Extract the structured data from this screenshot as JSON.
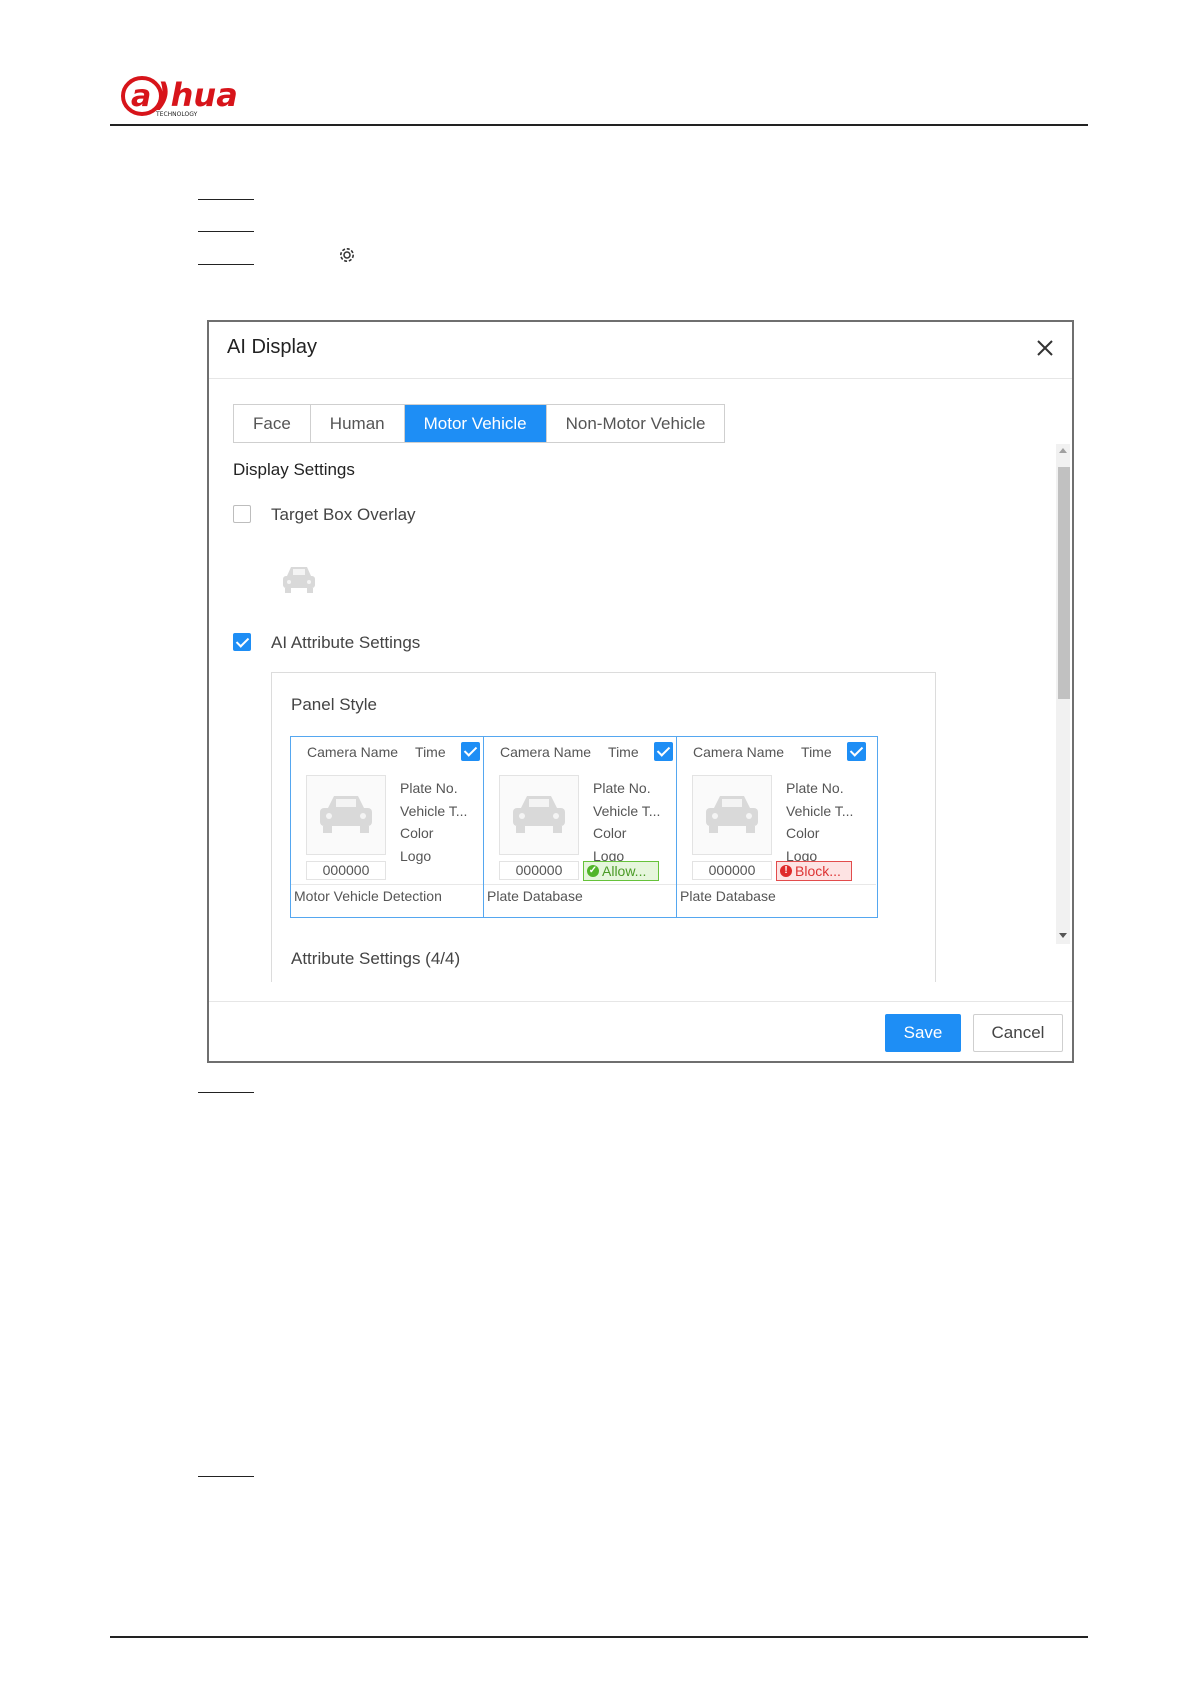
{
  "header": {
    "logo_text": "alhua",
    "logo_subtext": "TECHNOLOGY"
  },
  "dialog": {
    "title": "AI Display",
    "tabs": [
      {
        "label": "Face",
        "active": false
      },
      {
        "label": "Human",
        "active": false
      },
      {
        "label": "Motor Vehicle",
        "active": true
      },
      {
        "label": "Non-Motor Vehicle",
        "active": false
      }
    ],
    "display_settings_title": "Display Settings",
    "target_box_overlay": {
      "label": "Target Box Overlay",
      "checked": false
    },
    "ai_attribute_settings": {
      "label": "AI Attribute Settings",
      "checked": true
    },
    "panel_style_title": "Panel Style",
    "cards": [
      {
        "camera_name": "Camera Name",
        "time": "Time",
        "checked": true,
        "attributes": [
          "Plate No.",
          "Vehicle T...",
          "Color",
          "Logo"
        ],
        "plate_value": "000000",
        "badge": null,
        "footer": "Motor Vehicle Detection"
      },
      {
        "camera_name": "Camera Name",
        "time": "Time",
        "checked": true,
        "attributes": [
          "Plate No.",
          "Vehicle T...",
          "Color",
          "Logo"
        ],
        "plate_value": "000000",
        "badge": "Allow...",
        "badge_type": "allow",
        "footer": "Plate Database"
      },
      {
        "camera_name": "Camera Name",
        "time": "Time",
        "checked": true,
        "attributes": [
          "Plate No.",
          "Vehicle T...",
          "Color",
          "Logo"
        ],
        "plate_value": "000000",
        "badge": "Block...",
        "badge_type": "block",
        "footer": "Plate Database"
      }
    ],
    "attribute_settings_title": "Attribute Settings (4/4)",
    "save_label": "Save",
    "cancel_label": "Cancel"
  },
  "colors": {
    "accent": "#1e8ef5",
    "allow": "#52b52a",
    "block": "#e02a2a"
  }
}
